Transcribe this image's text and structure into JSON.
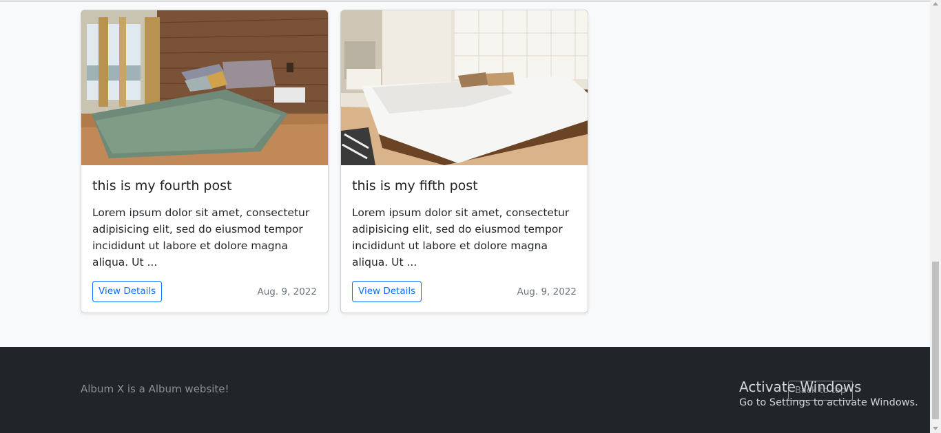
{
  "posts": [
    {
      "title": "this is my fourth post",
      "excerpt": "Lorem ipsum dolor sit amet, consectetur adipisicing elit, sed do eiusmod tempor incididunt ut labore et dolore magna aliqua. Ut ...",
      "button": "View Details",
      "date": "Aug. 9, 2022"
    },
    {
      "title": "this is my fifth post",
      "excerpt": "Lorem ipsum dolor sit amet, consectetur adipisicing elit, sed do eiusmod tempor incididunt ut labore et dolore magna aliqua. Ut ...",
      "button": "View Details",
      "date": "Aug. 9, 2022"
    }
  ],
  "footer": {
    "text": "Album X is a Album website!",
    "back_to_top": "Back to top"
  },
  "watermark": {
    "title": "Activate Windows",
    "subtitle": "Go to Settings to activate Windows."
  },
  "colors": {
    "accent": "#0d6efd",
    "footer_bg": "#212529",
    "page_bg": "#f8f9fa"
  }
}
